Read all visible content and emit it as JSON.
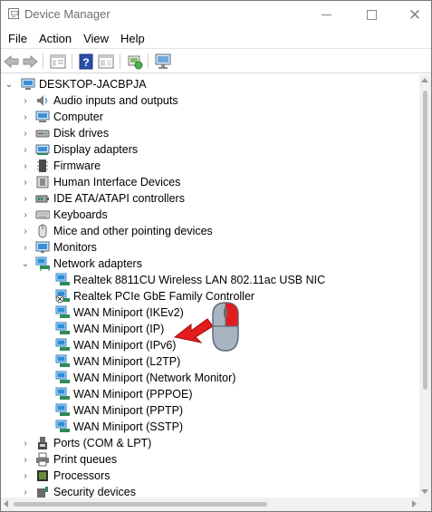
{
  "window": {
    "title": "Device Manager",
    "min_glyph": "",
    "max_glyph": "",
    "close_glyph": "✕"
  },
  "menu": [
    "File",
    "Action",
    "View",
    "Help"
  ],
  "toolbar": {
    "buttons": [
      "back-icon",
      "forward-icon",
      "properties-view-icon",
      "help-icon",
      "console-tree-icon",
      "scan-hardware-icon",
      "monitor-icon"
    ]
  },
  "tree": {
    "root": "DESKTOP-JACBPJA",
    "categories": [
      {
        "label": "Audio inputs and outputs",
        "icon": "speaker-icon",
        "expanded": false
      },
      {
        "label": "Computer",
        "icon": "computer-icon",
        "expanded": false
      },
      {
        "label": "Disk drives",
        "icon": "disk-drive-icon",
        "expanded": false
      },
      {
        "label": "Display adapters",
        "icon": "display-adapter-icon",
        "expanded": false
      },
      {
        "label": "Firmware",
        "icon": "firmware-icon",
        "expanded": false
      },
      {
        "label": "Human Interface Devices",
        "icon": "hid-icon",
        "expanded": false
      },
      {
        "label": "IDE ATA/ATAPI controllers",
        "icon": "ide-controller-icon",
        "expanded": false
      },
      {
        "label": "Keyboards",
        "icon": "keyboard-icon",
        "expanded": false
      },
      {
        "label": "Mice and other pointing devices",
        "icon": "mouse-icon",
        "expanded": false
      },
      {
        "label": "Monitors",
        "icon": "monitor-icon",
        "expanded": false
      },
      {
        "label": "Network adapters",
        "icon": "network-adapter-icon",
        "expanded": true
      },
      {
        "label": "Ports (COM & LPT)",
        "icon": "port-icon",
        "expanded": false
      },
      {
        "label": "Print queues",
        "icon": "printer-icon",
        "expanded": false
      },
      {
        "label": "Processors",
        "icon": "processor-icon",
        "expanded": false
      },
      {
        "label": "Security devices",
        "icon": "security-device-icon",
        "expanded": false
      }
    ],
    "network_adapters": [
      "Realtek 8811CU Wireless LAN 802.11ac USB NIC",
      "Realtek PCIe GbE Family Controller",
      "WAN Miniport (IKEv2)",
      "WAN Miniport (IP)",
      "WAN Miniport (IPv6)",
      "WAN Miniport (L2TP)",
      "WAN Miniport (Network Monitor)",
      "WAN Miniport (PPPOE)",
      "WAN Miniport (PPTP)",
      "WAN Miniport (SSTP)"
    ]
  },
  "colors": {
    "accent_red": "#e21c1c",
    "mouse_gray": "#a9b4c2",
    "network_blue": "#2a8fd6"
  }
}
